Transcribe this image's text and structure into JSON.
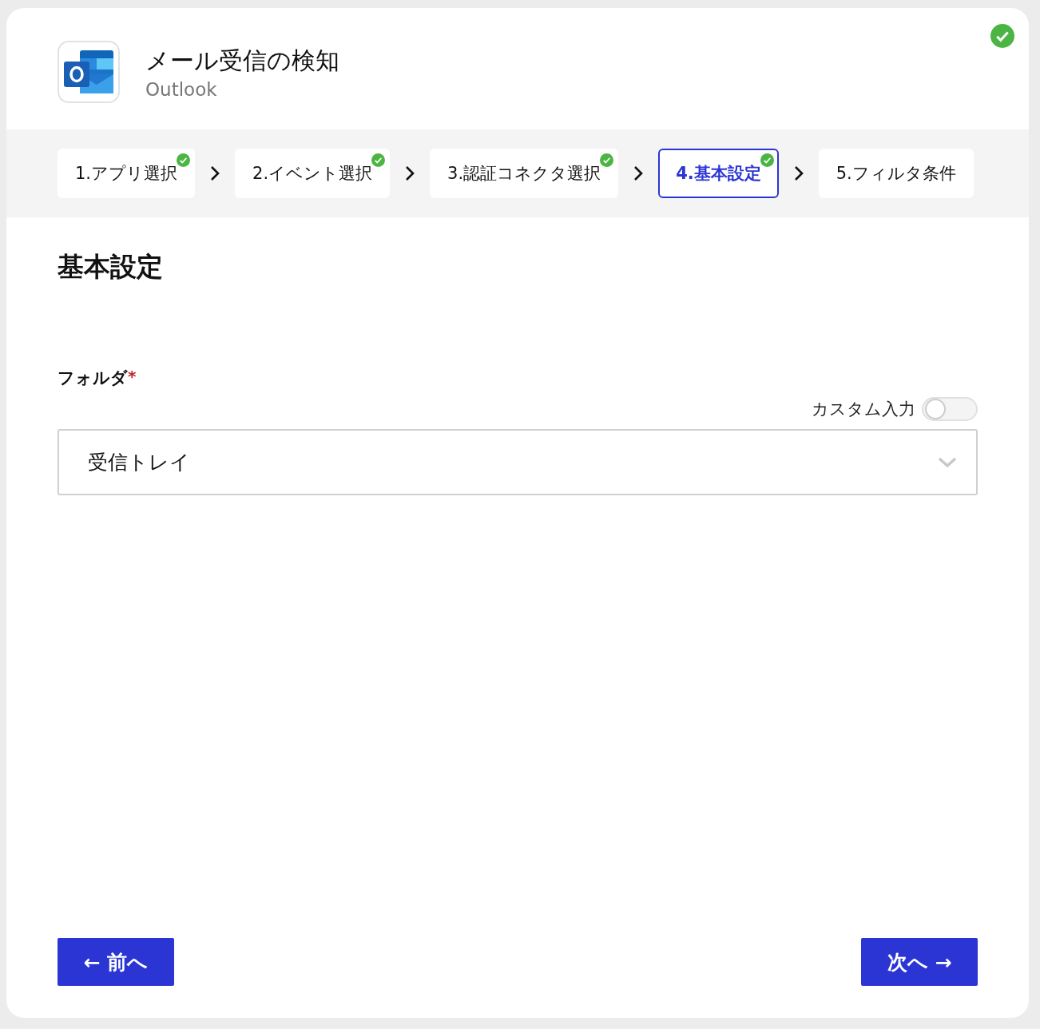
{
  "header": {
    "title": "メール受信の検知",
    "app_name": "Outlook",
    "completed": true
  },
  "steps": [
    {
      "label": "1.アプリ選択",
      "completed": true,
      "selected": false
    },
    {
      "label": "2.イベント選択",
      "completed": true,
      "selected": false
    },
    {
      "label": "3.認証コネクタ選択",
      "completed": true,
      "selected": false
    },
    {
      "label": "4.基本設定",
      "completed": true,
      "selected": true
    },
    {
      "label": "5.フィルタ条件",
      "completed": false,
      "selected": false
    }
  ],
  "section_title": "基本設定",
  "field": {
    "label": "フォルダ",
    "required_mark": "*",
    "required": true,
    "toggle_label": "カスタム入力",
    "custom_input": false,
    "value": "受信トレイ"
  },
  "buttons": {
    "back": "← 前へ",
    "next": "次へ →"
  }
}
